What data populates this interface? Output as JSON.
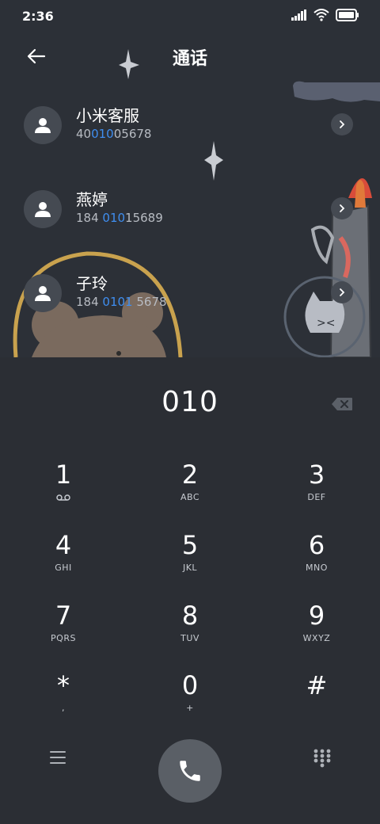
{
  "status": {
    "time": "2:36"
  },
  "header": {
    "title": "通话"
  },
  "contacts": [
    {
      "name": "小米客服",
      "num_pre": "40",
      "num_hl": "010",
      "num_post": "05678"
    },
    {
      "name": "燕婷",
      "num_pre": "184 ",
      "num_hl": "010",
      "num_post": "15689"
    },
    {
      "name": "子玲",
      "num_pre": "184 ",
      "num_hl": "0101",
      "num_post": " 5678"
    }
  ],
  "dialer": {
    "display": "010",
    "keys": [
      {
        "digit": "1",
        "letters": ""
      },
      {
        "digit": "2",
        "letters": "ABC"
      },
      {
        "digit": "3",
        "letters": "DEF"
      },
      {
        "digit": "4",
        "letters": "GHI"
      },
      {
        "digit": "5",
        "letters": "JKL"
      },
      {
        "digit": "6",
        "letters": "MNO"
      },
      {
        "digit": "7",
        "letters": "PQRS"
      },
      {
        "digit": "8",
        "letters": "TUV"
      },
      {
        "digit": "9",
        "letters": "WXYZ"
      },
      {
        "digit": "*",
        "letters": ","
      },
      {
        "digit": "0",
        "letters": "+"
      },
      {
        "digit": "#",
        "letters": ""
      }
    ]
  },
  "icons": {
    "voicemail": "voicemail-icon",
    "menu": "menu-icon",
    "call": "phone-icon",
    "keypad": "keypad-icon",
    "backspace": "backspace-icon"
  }
}
